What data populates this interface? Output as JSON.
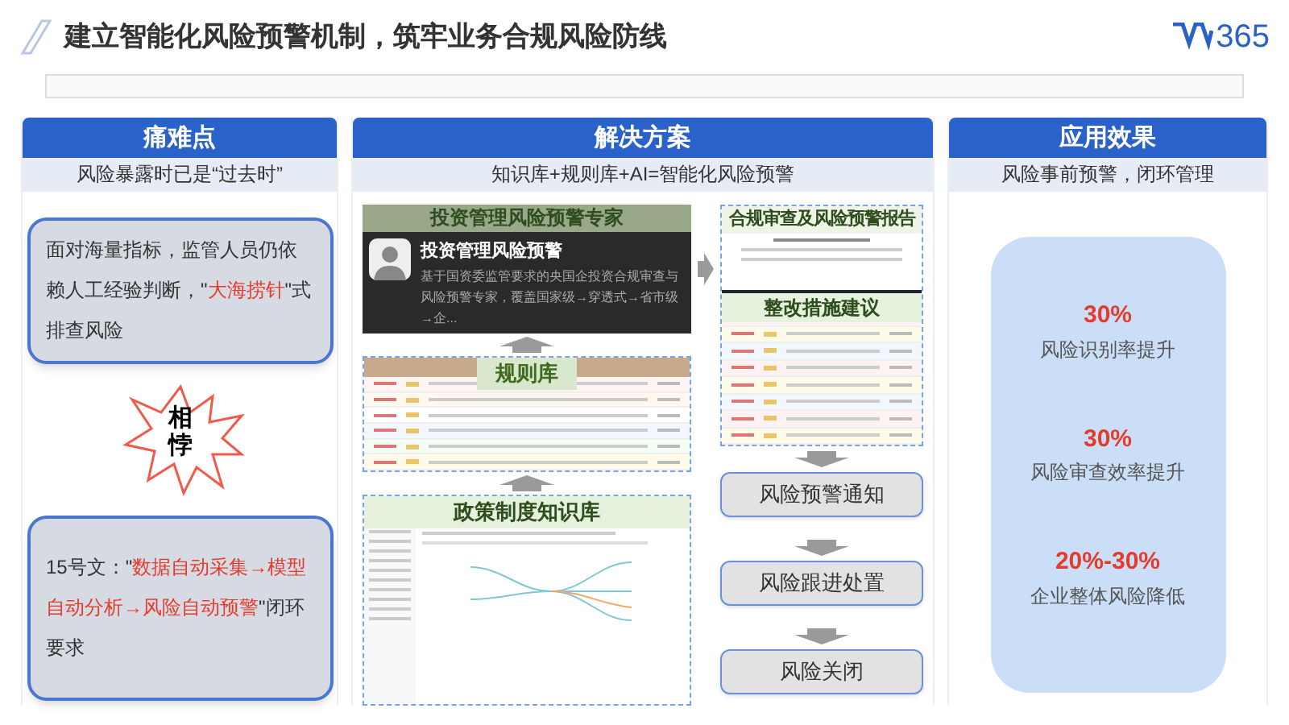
{
  "title": "建立智能化风险预警机制，筑牢业务合规风险防线",
  "logo": {
    "text": "365"
  },
  "pain_points": {
    "header": "痛难点",
    "subheader": "风险暴露时已是“过去时”",
    "cards": [
      {
        "segments": [
          {
            "text": "面对海量指标，监管人员仍依赖人工经验判断，\"",
            "highlight": false
          },
          {
            "text": "大海捞针",
            "highlight": true
          },
          {
            "text": "\"式排查风险",
            "highlight": false
          }
        ]
      },
      {
        "segments": [
          {
            "text": "15号文：\"",
            "highlight": false
          },
          {
            "text": "数据自动采集→模型自动分析→风险自动预警",
            "highlight": true
          },
          {
            "text": "\"闭环要求",
            "highlight": false
          }
        ]
      }
    ],
    "burst": "相悖"
  },
  "solution": {
    "header": "解决方案",
    "subheader": "知识库+规则库+AI=智能化风险预警",
    "expert": {
      "banner": "投资管理风险预警专家",
      "name": "投资管理风险预警",
      "description": "基于国资委监管要求的央国企投资合规审查与风险预警专家，覆盖国家级→穿透式→省市级→企..."
    },
    "rule_library": "规则库",
    "knowledge_base": "政策制度知识库",
    "report": "合规审查及风险预警报告",
    "rectification": "整改措施建议",
    "steps": [
      "风险预警通知",
      "风险跟进处置",
      "风险关闭"
    ]
  },
  "effects": {
    "header": "应用效果",
    "subheader": "风险事前预警，闭环管理",
    "metrics": [
      {
        "value": "30%",
        "label": "风险识别率提升"
      },
      {
        "value": "30%",
        "label": "风险审查效率提升"
      },
      {
        "value": "20%-30%",
        "label": "企业整体风险降低"
      }
    ]
  }
}
